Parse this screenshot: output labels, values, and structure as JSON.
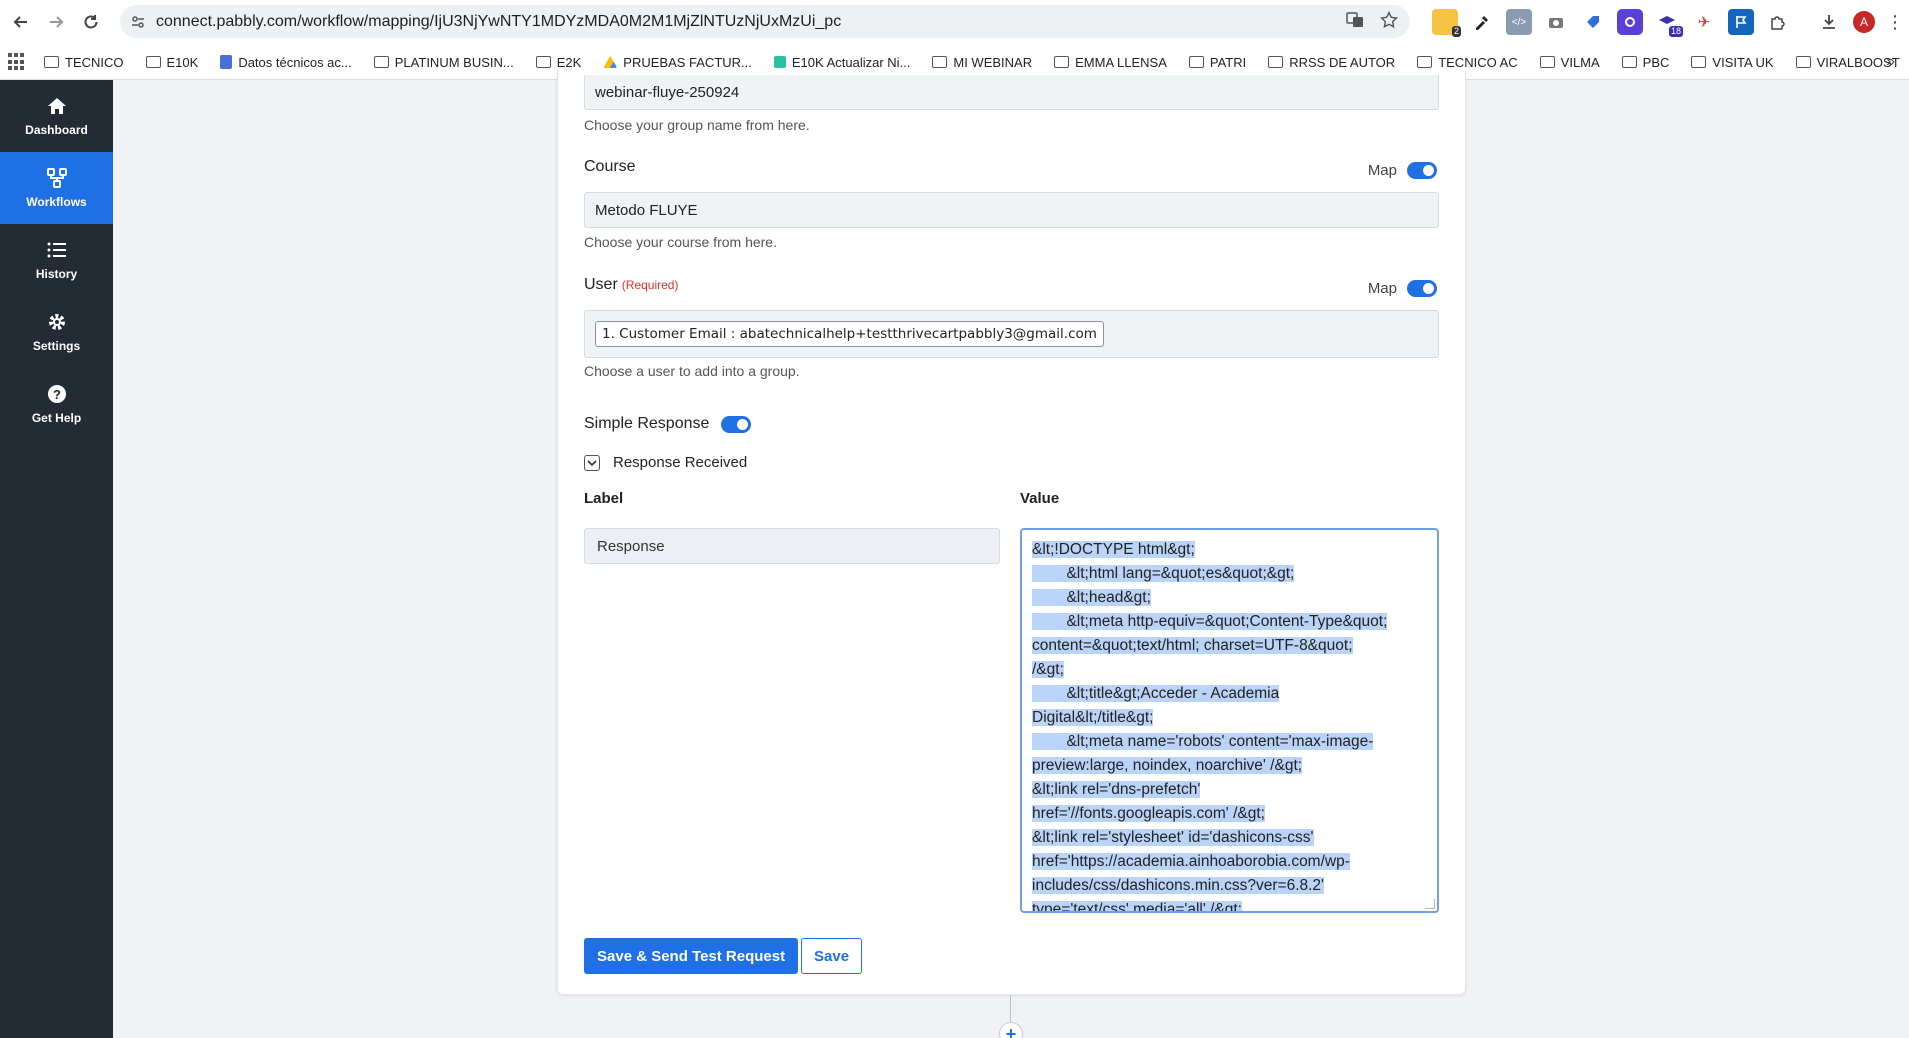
{
  "browser": {
    "url": "connect.pabbly.com/workflow/mapping/IjU3NjYwNTY1MDYzMDA0M2M1MjZlNTUzNjUxMzUi_pc",
    "ext_badges": [
      "2",
      "18"
    ],
    "avatar_letter": "A",
    "bookmarks": [
      {
        "label": "TECNICO",
        "icon": "folder"
      },
      {
        "label": "E10K",
        "icon": "folder"
      },
      {
        "label": "Datos técnicos ac...",
        "icon": "doc"
      },
      {
        "label": "PLATINUM BUSIN...",
        "icon": "folder"
      },
      {
        "label": "E2K",
        "icon": "folder"
      },
      {
        "label": "PRUEBAS FACTUR...",
        "icon": "drive"
      },
      {
        "label": "E10K Actualizar Ni...",
        "icon": "e10k"
      },
      {
        "label": "MI WEBINAR",
        "icon": "folder"
      },
      {
        "label": "EMMA LLENSA",
        "icon": "folder"
      },
      {
        "label": "PATRI",
        "icon": "folder"
      },
      {
        "label": "RRSS DE AUTOR",
        "icon": "folder"
      },
      {
        "label": "TECNICO AC",
        "icon": "folder"
      },
      {
        "label": "VILMA",
        "icon": "folder"
      },
      {
        "label": "PBC",
        "icon": "folder"
      },
      {
        "label": "VISITA UK",
        "icon": "folder"
      },
      {
        "label": "VIRALBOOST",
        "icon": "folder"
      }
    ]
  },
  "sidebar": {
    "items": [
      {
        "label": "Dashboard",
        "icon": "home-icon",
        "active": false
      },
      {
        "label": "Workflows",
        "icon": "workflow-icon",
        "active": true
      },
      {
        "label": "History",
        "icon": "list-icon",
        "active": false
      },
      {
        "label": "Settings",
        "icon": "gear-icon",
        "active": false
      },
      {
        "label": "Get Help",
        "icon": "help-icon",
        "active": false
      }
    ]
  },
  "form": {
    "group": {
      "value": "webinar-fluye-250924",
      "help": "Choose your group name from here."
    },
    "course": {
      "label": "Course",
      "map_label": "Map",
      "value": "Metodo FLUYE",
      "help": "Choose your course from here."
    },
    "user": {
      "label": "User",
      "required": "(Required)",
      "map_label": "Map",
      "chip": "1. Customer Email : abatechnicalhelp+testthrivecartpabbly3@gmail.com",
      "help": "Choose a user to add into a group."
    },
    "simple_response": {
      "label": "Simple Response",
      "enabled": true
    },
    "response_received": {
      "label": "Response Received",
      "checked": true
    },
    "columns": {
      "label": "Label",
      "value": "Value"
    },
    "response_label": "Response",
    "response_value_lines": [
      "&lt;!DOCTYPE html&gt;",
      "        &lt;html lang=&quot;es&quot;&gt;",
      "        &lt;head&gt;",
      "        &lt;meta http-equiv=&quot;Content-Type&quot;",
      "content=&quot;text/html; charset=UTF-8&quot;",
      "/&gt;",
      "        &lt;title&gt;Acceder - Academia",
      "Digital&lt;/title&gt;",
      "        &lt;meta name='robots' content='max-image-",
      "preview:large, noindex, noarchive' /&gt;",
      "&lt;link rel='dns-prefetch'",
      "href='//fonts.googleapis.com' /&gt;",
      "&lt;link rel='stylesheet' id='dashicons-css'",
      "href='https://academia.ainhoaborobia.com/wp-",
      "includes/css/dashicons.min.css?ver=6.8.2'",
      "type='text/css' media='all' /&gt;"
    ],
    "buttons": {
      "save_send": "Save & Send Test Request",
      "save": "Save"
    }
  },
  "add_step_symbol": "+"
}
